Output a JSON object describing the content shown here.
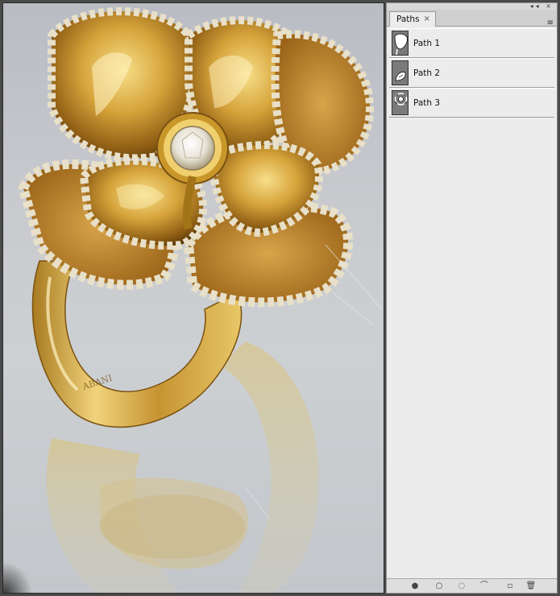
{
  "panel": {
    "tab_label": "Paths",
    "close_glyph": "×",
    "menu_glyph": "≡",
    "top_controls": "◂◂ ×"
  },
  "paths": [
    {
      "label": "Path 1",
      "icon": "path-1-thumbnail-icon"
    },
    {
      "label": "Path 2",
      "icon": "path-2-thumbnail-icon"
    },
    {
      "label": "Path 3",
      "icon": "path-3-thumbnail-icon"
    }
  ],
  "bottom_buttons": [
    {
      "name": "fill-path-button",
      "glyph": "●"
    },
    {
      "name": "stroke-path-button",
      "glyph": "○"
    },
    {
      "name": "load-as-selection-button",
      "glyph": "◌"
    },
    {
      "name": "make-work-path-button",
      "glyph": "⌒"
    },
    {
      "name": "new-path-button",
      "glyph": "▫"
    },
    {
      "name": "delete-path-button",
      "glyph": "🗑"
    }
  ],
  "colors": {
    "panel_bg": "#ececec",
    "gold_light": "#f3d77a",
    "gold_mid": "#c9962a",
    "gold_dark": "#7a4f10",
    "backdrop": "#c8cace"
  }
}
